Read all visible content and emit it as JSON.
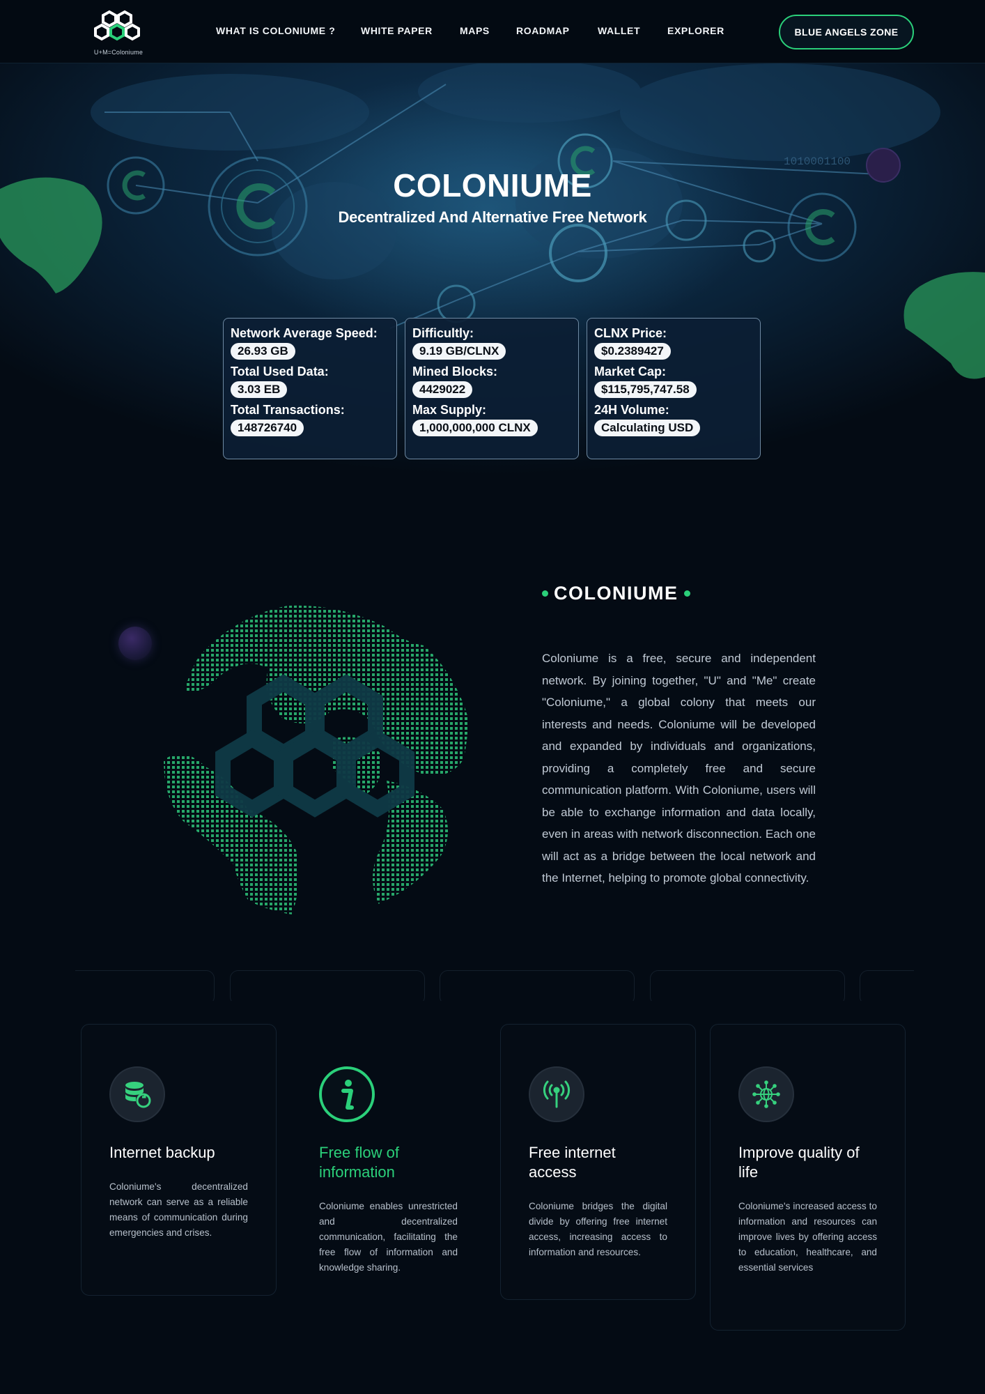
{
  "brand": {
    "logo_caption": "U+M=Coloniume",
    "accent": "#2bd07a"
  },
  "nav": {
    "items": [
      "WHAT IS COLONIUME ?",
      "WHITE PAPER",
      "MAPS",
      "ROADMAP",
      "WALLET",
      "EXPLORER"
    ],
    "cta": "BLUE ANGELS ZONE"
  },
  "hero": {
    "title": "COLONIUME",
    "subtitle": "Decentralized And Alternative Free Network",
    "stats": [
      [
        {
          "label": "Network Average Speed:",
          "value": "26.93 GB"
        },
        {
          "label": "Total Used Data:",
          "value": "3.03 EB"
        },
        {
          "label": "Total Transactions:",
          "value": "148726740"
        }
      ],
      [
        {
          "label": "Difficultly:",
          "value": "9.19 GB/CLNX"
        },
        {
          "label": "Mined Blocks:",
          "value": "4429022"
        },
        {
          "label": "Max Supply:",
          "value": "1,000,000,000 CLNX"
        }
      ],
      [
        {
          "label": "CLNX Price:",
          "value": "$0.2389427"
        },
        {
          "label": "Market Cap:",
          "value": "$115,795,747.58"
        },
        {
          "label": "24H Volume:",
          "value": "Calculating USD"
        }
      ]
    ],
    "bg_code_text": "1010001100"
  },
  "about": {
    "heading": "COLONIUME",
    "text": "Coloniume is a free, secure and independent network. By joining together, \"U\" and \"Me\" create \"Coloniume,\" a global colony that meets our interests and needs. Coloniume will be developed and expanded by individuals and organizations, providing a completely free and secure communication platform. With Coloniume, users will be able to exchange information and data locally, even in areas with network disconnection. Each one will act as a bridge between the local network and the Internet, helping to promote global connectivity."
  },
  "features": [
    {
      "icon": "database-restore-icon",
      "title": "Internet backup",
      "desc": "Coloniume's decentralized network can serve as a reliable means of communication during emergencies and crises.",
      "active": false
    },
    {
      "icon": "info-icon",
      "title": "Free flow of information",
      "desc": "Coloniume enables unrestricted and decentralized communication, facilitating the free flow of information and knowledge sharing.",
      "active": true
    },
    {
      "icon": "antenna-icon",
      "title": "Free internet access",
      "desc": "Coloniume bridges the digital divide by offering free internet access, increasing access to information and resources.",
      "active": false
    },
    {
      "icon": "globe-network-icon",
      "title": "Improve quality of life",
      "desc": "Coloniume's increased access to information and resources can improve lives by offering access to education, healthcare, and essential services",
      "active": false
    }
  ]
}
